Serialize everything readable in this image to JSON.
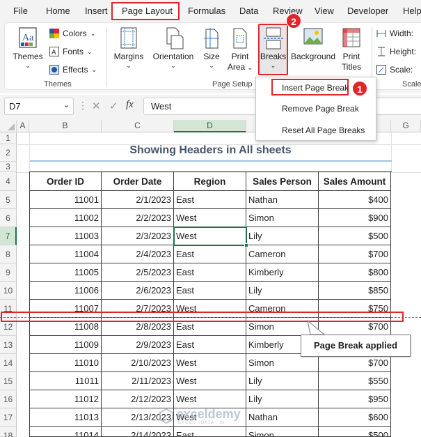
{
  "menu": {
    "tabs": [
      "File",
      "Home",
      "Insert",
      "Page Layout",
      "Formulas",
      "Data",
      "Review",
      "View",
      "Developer",
      "Help"
    ],
    "active": "Page Layout"
  },
  "ribbon": {
    "themes": {
      "themes": "Themes",
      "colors": "Colors",
      "fonts": "Fonts",
      "effects": "Effects",
      "group": "Themes"
    },
    "page_setup": {
      "margins": "Margins",
      "orientation": "Orientation",
      "size": "Size",
      "print_area_1": "Print",
      "print_area_2": "Area",
      "breaks": "Breaks",
      "background": "Background",
      "print_titles_1": "Print",
      "print_titles_2": "Titles",
      "group": "Page Setup"
    },
    "scale": {
      "width": "Width:",
      "height": "Height:",
      "scale": "Scale:",
      "group": "Scale"
    }
  },
  "dropdown": {
    "items": [
      "Insert Page Break",
      "Remove Page Break",
      "Reset All Page Breaks"
    ]
  },
  "badges": {
    "one": "1",
    "two": "2"
  },
  "formula_bar": {
    "name_box": "D7",
    "value": "West"
  },
  "columns": [
    "A",
    "B",
    "C",
    "D",
    "E",
    "F",
    "G"
  ],
  "rows": [
    "1",
    "2",
    "3",
    "4",
    "5",
    "6",
    "7",
    "8",
    "9",
    "10",
    "11",
    "12",
    "13",
    "14",
    "15",
    "16",
    "17",
    "18"
  ],
  "sheet": {
    "title": "Showing Headers in All sheets",
    "headers": [
      "Order ID",
      "Order Date",
      "Region",
      "Sales Person",
      "Sales Amount"
    ],
    "data": [
      [
        "11001",
        "2/1/2023",
        "East",
        "Nathan",
        "$400"
      ],
      [
        "11002",
        "2/2/2023",
        "West",
        "Simon",
        "$900"
      ],
      [
        "11003",
        "2/3/2023",
        "West",
        "Lily",
        "$500"
      ],
      [
        "11004",
        "2/4/2023",
        "East",
        "Cameron",
        "$700"
      ],
      [
        "11005",
        "2/5/2023",
        "East",
        "Kimberly",
        "$800"
      ],
      [
        "11006",
        "2/6/2023",
        "East",
        "Lily",
        "$850"
      ],
      [
        "11007",
        "2/7/2023",
        "West",
        "Cameron",
        "$750"
      ],
      [
        "11008",
        "2/8/2023",
        "East",
        "Simon",
        "$700"
      ],
      [
        "11009",
        "2/9/2023",
        "East",
        "Kimberly",
        "$700"
      ],
      [
        "11010",
        "2/10/2023",
        "West",
        "Simon",
        "$700"
      ],
      [
        "11011",
        "2/11/2023",
        "West",
        "Lily",
        "$550"
      ],
      [
        "11012",
        "2/12/2023",
        "West",
        "Lily",
        "$950"
      ],
      [
        "11013",
        "2/13/2023",
        "West",
        "Nathan",
        "$600"
      ],
      [
        "11014",
        "2/14/2023",
        "East",
        "Simon",
        "$500"
      ]
    ]
  },
  "callout": "Page Break applied",
  "watermark": {
    "name": "exceldemy",
    "sub": "EXCEL · DATA · BI"
  },
  "colors": {
    "accent": "#e0262b",
    "excel_green": "#217346",
    "title": "#44546a"
  }
}
